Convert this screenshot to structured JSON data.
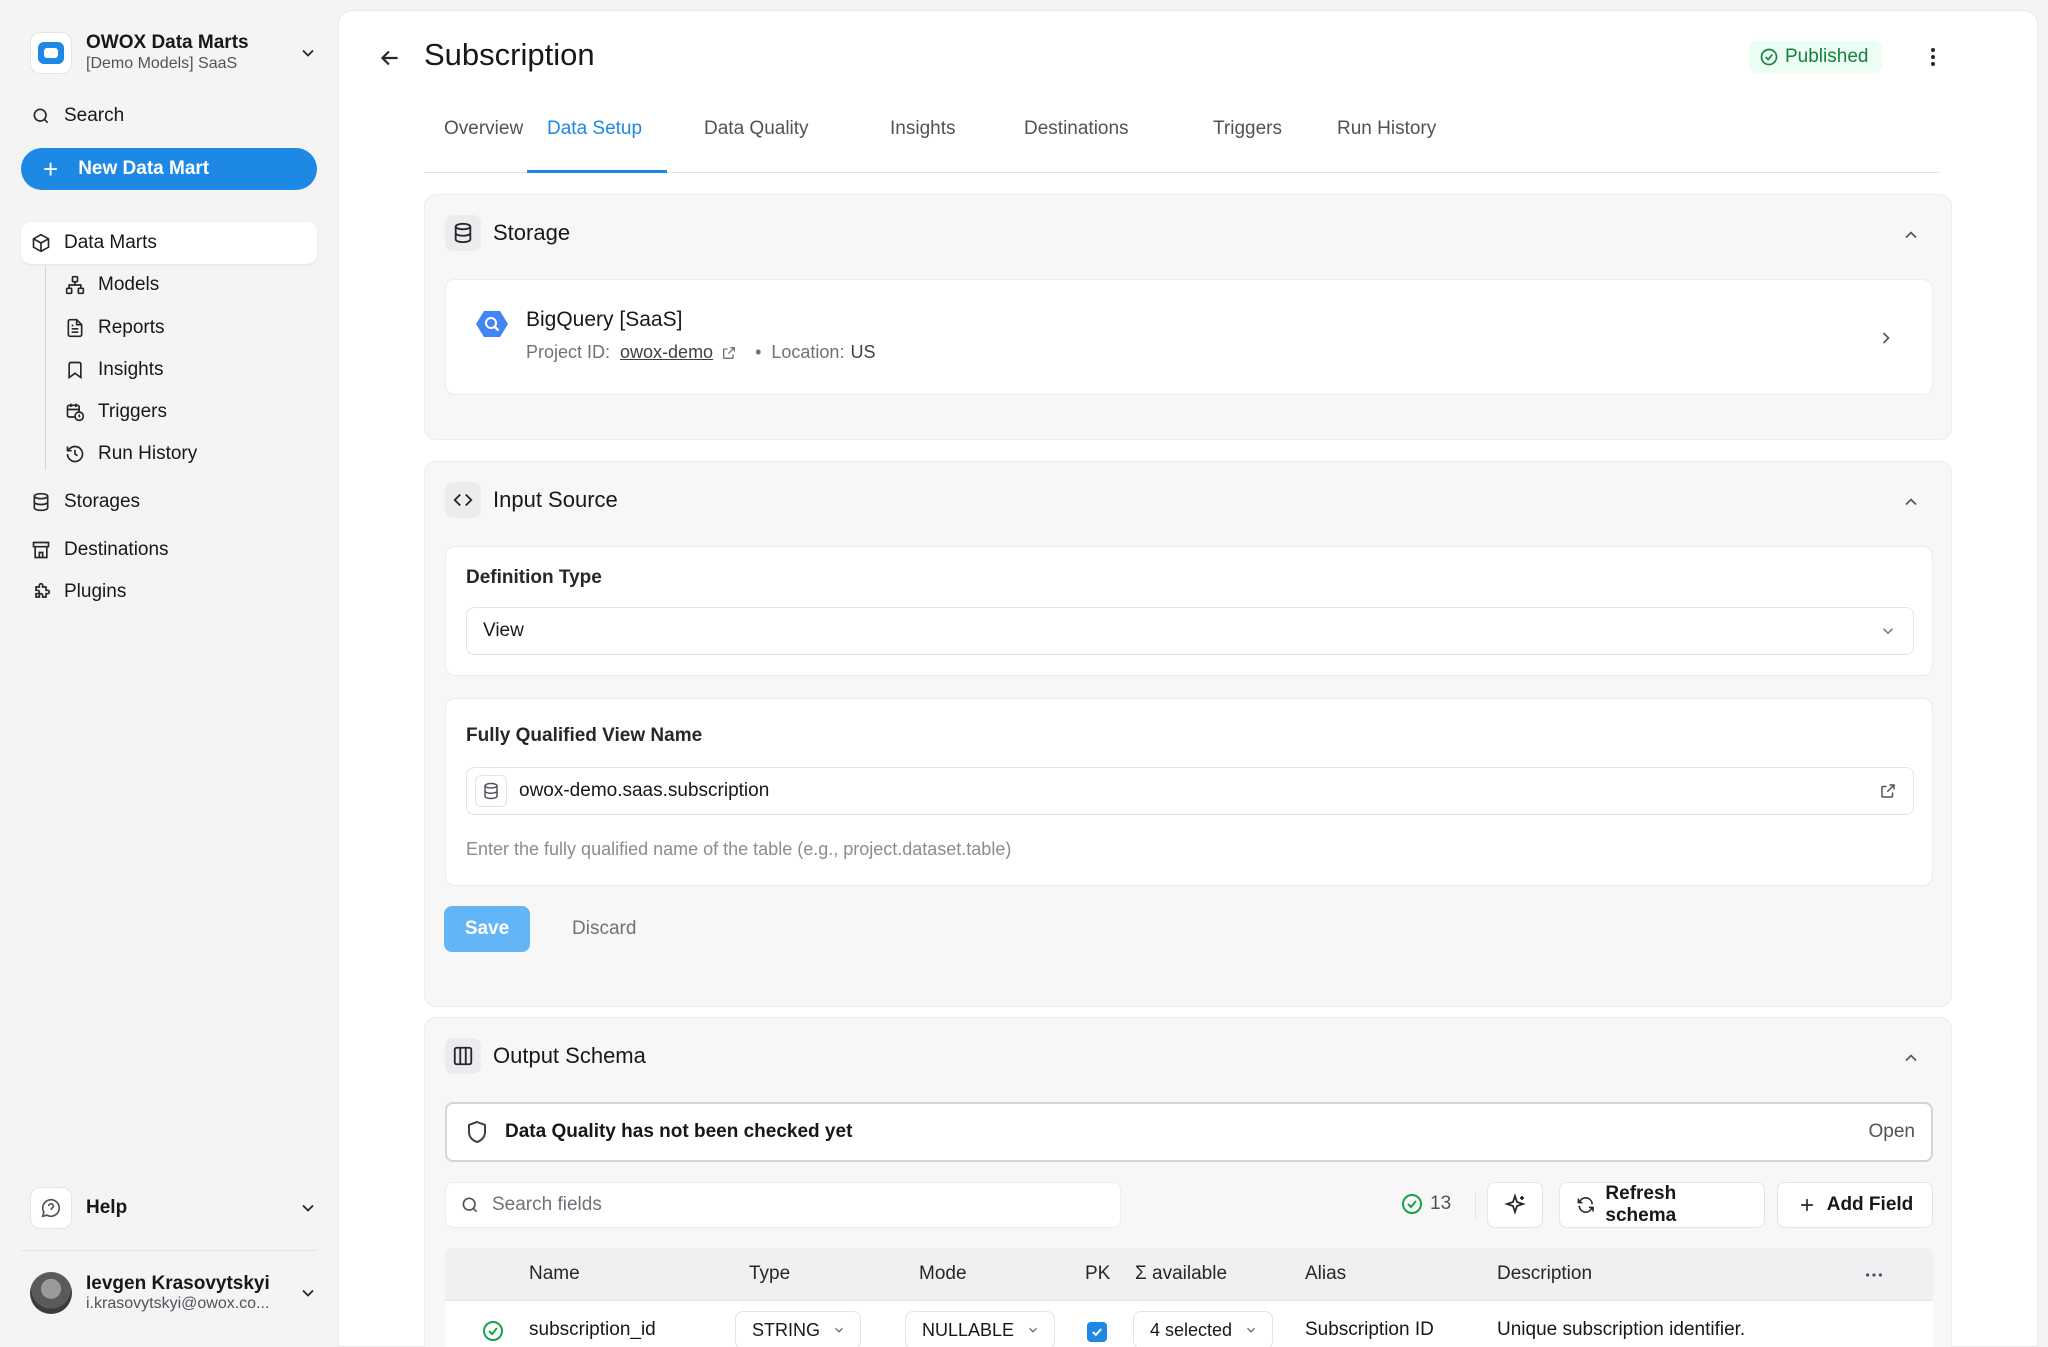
{
  "workspace": {
    "title": "OWOX Data Marts",
    "subtitle": "[Demo Models] SaaS"
  },
  "sidebar": {
    "search_label": "Search",
    "new_button": "New Data Mart",
    "items": [
      {
        "label": "Data Marts",
        "icon": "cube-icon"
      },
      {
        "label": "Models",
        "icon": "model-icon"
      },
      {
        "label": "Reports",
        "icon": "report-icon"
      },
      {
        "label": "Insights",
        "icon": "bookmark-icon"
      },
      {
        "label": "Triggers",
        "icon": "calendar-clock-icon"
      },
      {
        "label": "Run History",
        "icon": "history-icon"
      },
      {
        "label": "Storages",
        "icon": "database-icon"
      },
      {
        "label": "Destinations",
        "icon": "store-icon"
      },
      {
        "label": "Plugins",
        "icon": "puzzle-icon"
      }
    ],
    "help_label": "Help",
    "user": {
      "name": "Ievgen Krasovytskyi",
      "email": "i.krasovytskyi@owox.co..."
    }
  },
  "page": {
    "title": "Subscription",
    "status": "Published",
    "tabs": [
      "Overview",
      "Data Setup",
      "Data Quality",
      "Insights",
      "Destinations",
      "Triggers",
      "Run History"
    ],
    "active_tab": "Data Setup"
  },
  "storage": {
    "heading": "Storage",
    "name": "BigQuery [SaaS]",
    "project_label": "Project ID:",
    "project_id": "owox-demo",
    "location_label": "Location:",
    "location": "US"
  },
  "input_source": {
    "heading": "Input Source",
    "definition_type_label": "Definition Type",
    "definition_type_value": "View",
    "view_name_label": "Fully Qualified View Name",
    "view_name_value": "owox-demo.saas.subscription",
    "view_name_hint": "Enter the fully qualified name of the table (e.g., project.dataset.table)",
    "save_label": "Save",
    "discard_label": "Discard"
  },
  "output_schema": {
    "heading": "Output Schema",
    "dq_message": "Data Quality has not been checked yet",
    "dq_open": "Open",
    "search_placeholder": "Search fields",
    "field_count": "13",
    "refresh_label": "Refresh schema",
    "add_field_label": "Add Field",
    "columns": [
      "Name",
      "Type",
      "Mode",
      "PK",
      "Σ available",
      "Alias",
      "Description"
    ],
    "rows": [
      {
        "name": "subscription_id",
        "type": "STRING",
        "mode": "NULLABLE",
        "pk": true,
        "available": "4 selected",
        "alias": "Subscription ID",
        "description": "Unique subscription identifier."
      }
    ]
  },
  "colors": {
    "accent": "#1e88e5",
    "success": "#15803d"
  }
}
